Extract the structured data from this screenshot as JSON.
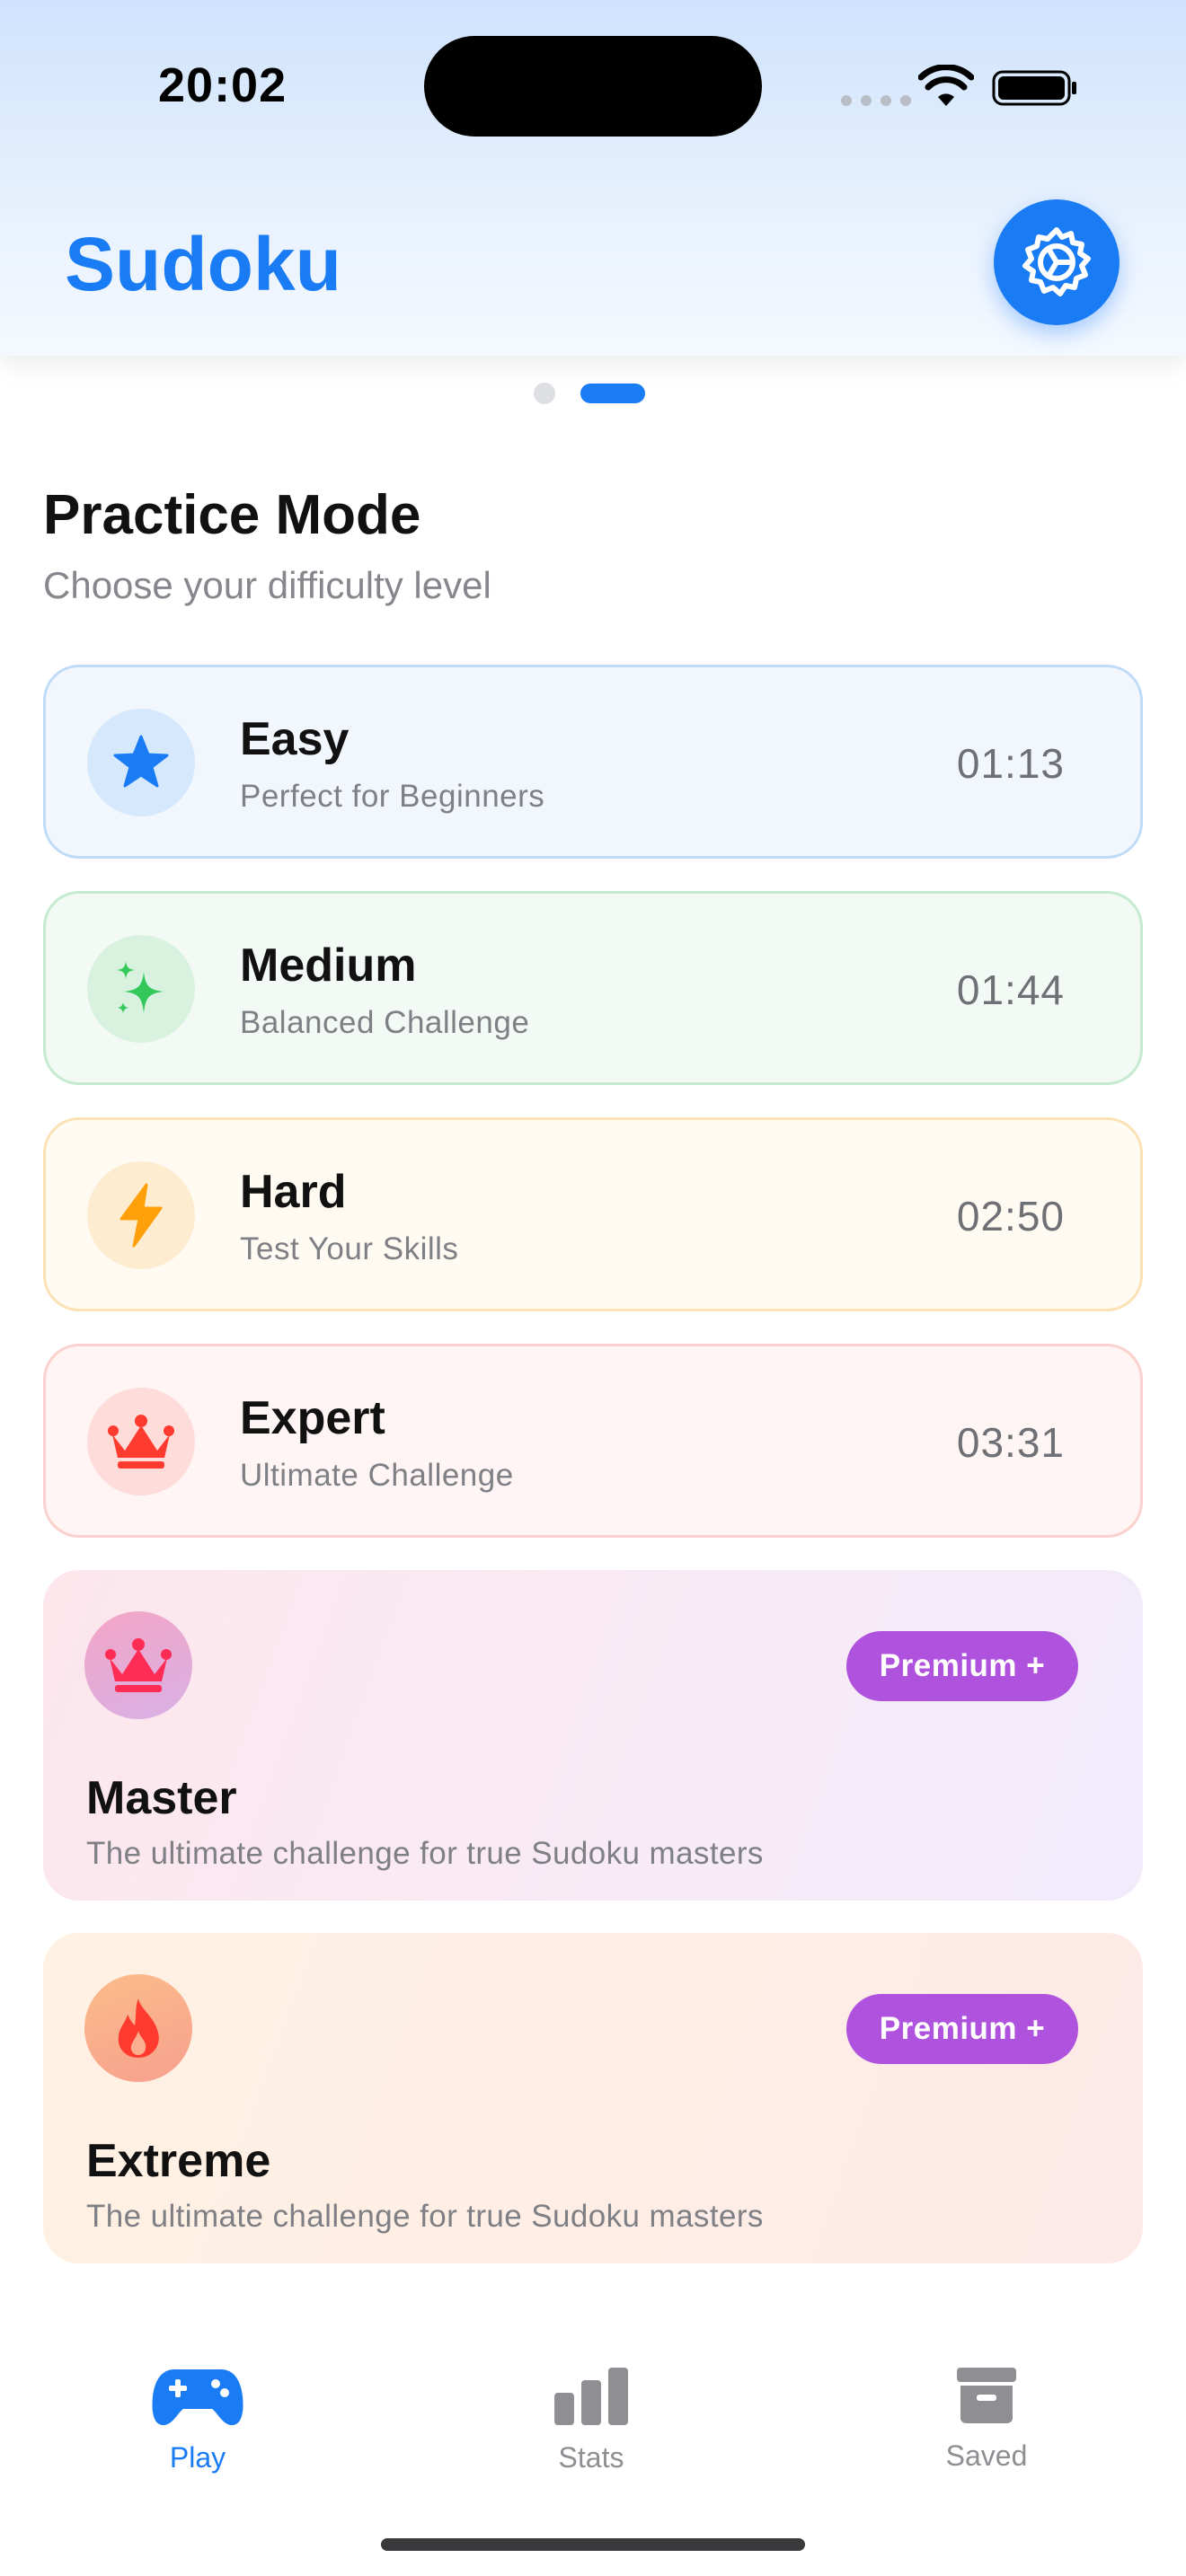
{
  "status_bar": {
    "time": "20:02"
  },
  "header": {
    "title": "Sudoku",
    "settings_icon": "gear-icon"
  },
  "pager": {
    "count": 2,
    "active_index": 1
  },
  "section": {
    "title": "Practice Mode",
    "subtitle": "Choose your difficulty level"
  },
  "levels": [
    {
      "name": "Easy",
      "description": "Perfect for Beginners",
      "time": "01:13",
      "icon": "star-icon",
      "accent": "#1a7cf5"
    },
    {
      "name": "Medium",
      "description": "Balanced Challenge",
      "time": "01:44",
      "icon": "sparkles-icon",
      "accent": "#34c759"
    },
    {
      "name": "Hard",
      "description": "Test Your Skills",
      "time": "02:50",
      "icon": "bolt-icon",
      "accent": "#ff9f0a"
    },
    {
      "name": "Expert",
      "description": "Ultimate Challenge",
      "time": "03:31",
      "icon": "crown-icon",
      "accent": "#ff3b30"
    }
  ],
  "premium": [
    {
      "name": "Master",
      "description": "The ultimate challenge for true Sudoku masters",
      "badge": "Premium +",
      "icon": "crown-icon"
    },
    {
      "name": "Extreme",
      "description": "The ultimate challenge for true Sudoku masters",
      "badge": "Premium +",
      "icon": "flame-icon"
    }
  ],
  "tabs": [
    {
      "label": "Play",
      "icon": "gamecontroller-icon",
      "active": true
    },
    {
      "label": "Stats",
      "icon": "chart-bars-icon",
      "active": false
    },
    {
      "label": "Saved",
      "icon": "archivebox-icon",
      "active": false
    }
  ],
  "colors": {
    "accent": "#1a7cf5",
    "premium_badge": "#af52de",
    "inactive_tab": "#8e8e93"
  }
}
